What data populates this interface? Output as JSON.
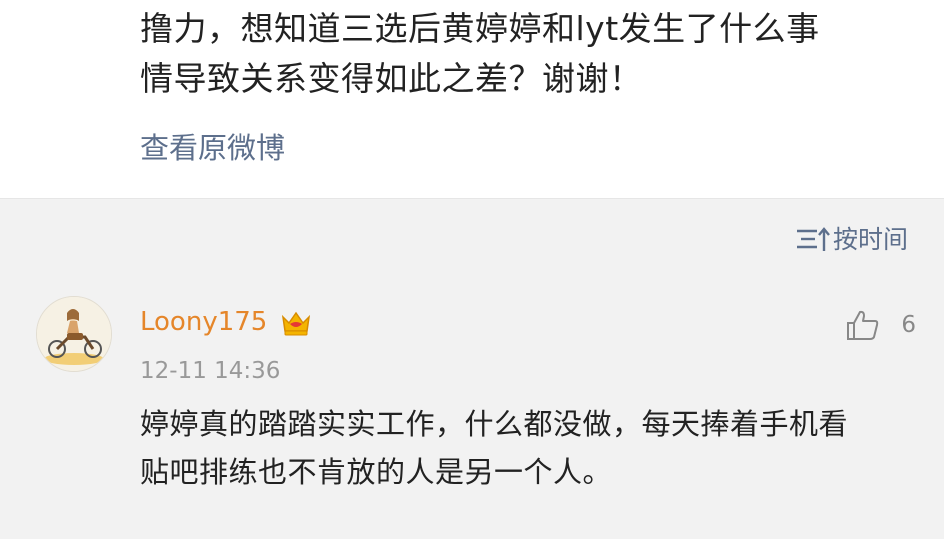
{
  "post": {
    "text_line1": "撸力，想知道三选后黄婷婷和lyt发生了什么事",
    "text_line2": "情导致关系变得如此之差？谢谢！",
    "view_original": "查看原微博"
  },
  "sort": {
    "label": "按时间",
    "icon": "sort-icon"
  },
  "comment": {
    "username": "Loony175",
    "badge_icon": "crown-icon",
    "timestamp": "12-11 14:36",
    "like_icon": "thumbs-up-icon",
    "like_count": "6",
    "text_line1": "婷婷真的踏踏实实工作，什么都没做，每天捧着手机看",
    "text_line2": "贴吧排练也不肯放的人是另一个人。"
  },
  "colors": {
    "link": "#5d6f8c",
    "username": "#e5862a",
    "text": "#222222",
    "meta": "#999999",
    "background": "#f2f2f2"
  }
}
